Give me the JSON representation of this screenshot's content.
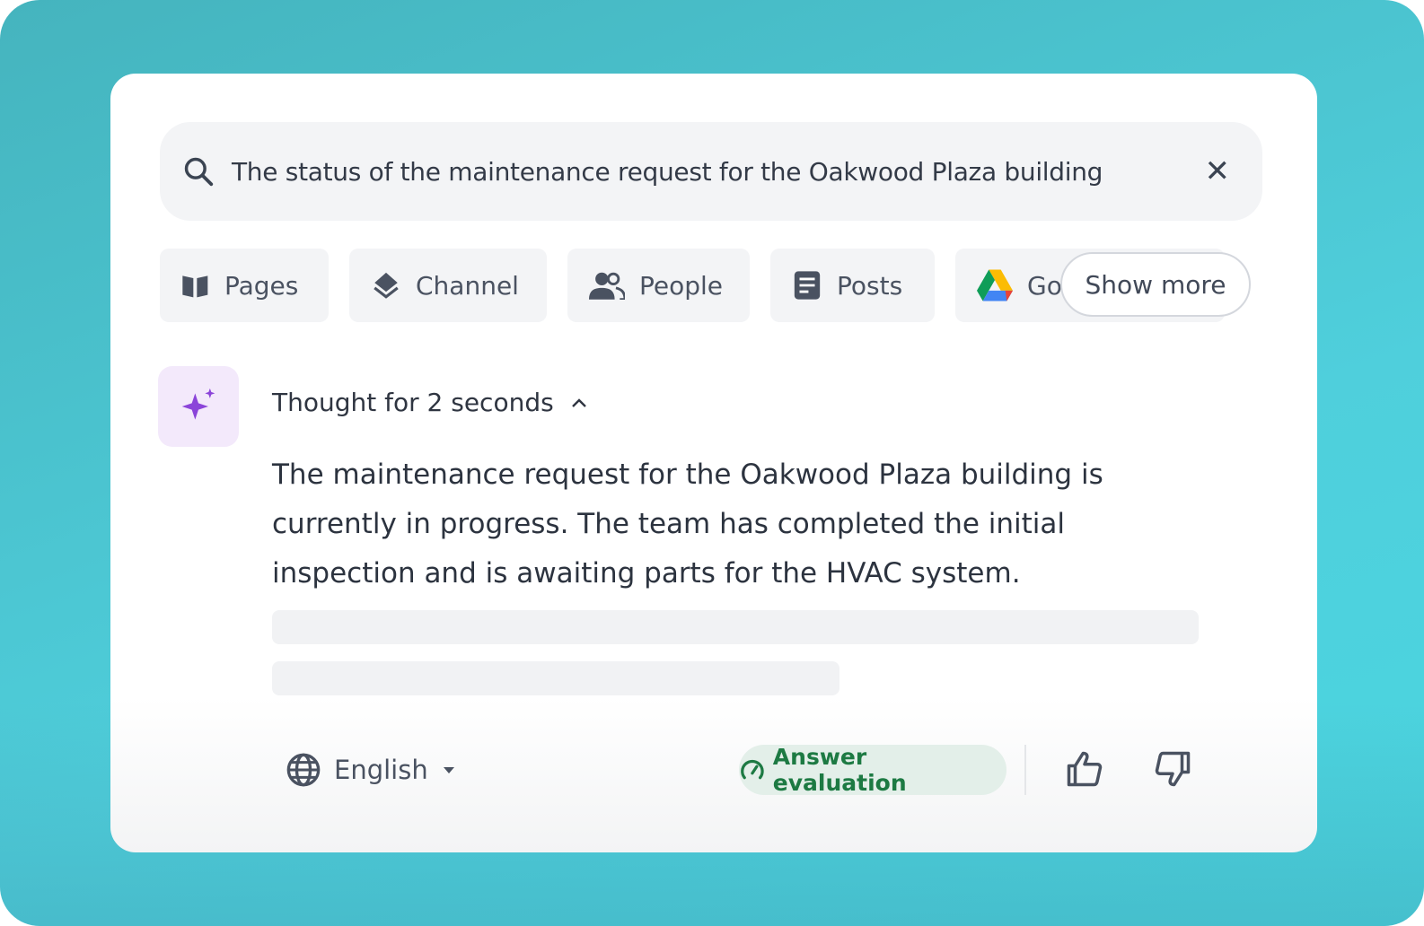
{
  "search": {
    "query": "The status of the maintenance request for the Oakwood Plaza building",
    "icon": "search-icon",
    "clear_icon": "close-icon"
  },
  "filters": [
    {
      "label": "Pages",
      "icon": "book-icon"
    },
    {
      "label": "Channel",
      "icon": "layers-icon"
    },
    {
      "label": "People",
      "icon": "people-icon"
    },
    {
      "label": "Posts",
      "icon": "document-icon"
    },
    {
      "label": "Goo",
      "icon": "google-drive-icon"
    }
  ],
  "show_more": "Show more",
  "assistant": {
    "thought": "Thought for 2 seconds",
    "answer": "The maintenance request for the Oakwood Plaza building is currently in progress. The team has completed the initial inspection and is awaiting parts for the HVAC system.",
    "accent": "#8b44d9"
  },
  "footer": {
    "language": "English",
    "evaluation": "Answer evaluation",
    "evaluation_color": "#1d7a43"
  }
}
